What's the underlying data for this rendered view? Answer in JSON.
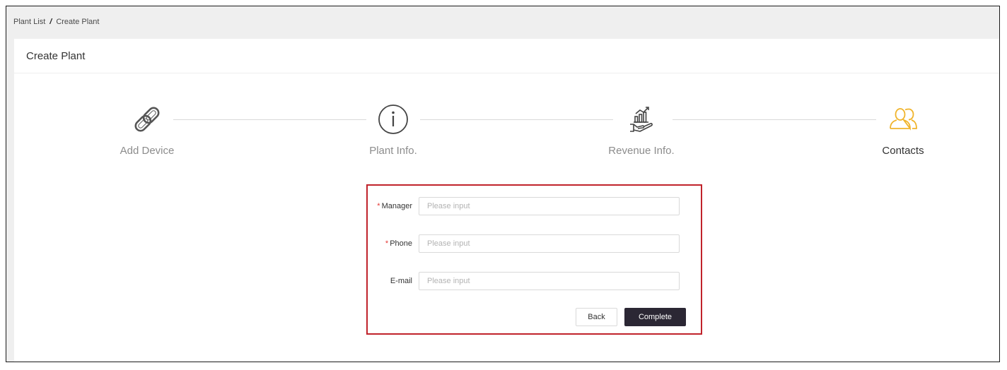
{
  "breadcrumb": {
    "items": [
      "Plant List",
      "Create Plant"
    ],
    "separator": "/"
  },
  "page": {
    "title": "Create Plant"
  },
  "steps": [
    {
      "label": "Add Device",
      "icon": "link-icon",
      "active": false
    },
    {
      "label": "Plant Info.",
      "icon": "info-icon",
      "active": false
    },
    {
      "label": "Revenue Info.",
      "icon": "revenue-icon",
      "active": false
    },
    {
      "label": "Contacts",
      "icon": "contacts-icon",
      "active": true
    }
  ],
  "form": {
    "fields": [
      {
        "label": "Manager",
        "required": true,
        "value": "",
        "placeholder": "Please input"
      },
      {
        "label": "Phone",
        "required": true,
        "value": "",
        "placeholder": "Please input"
      },
      {
        "label": "E-mail",
        "required": false,
        "value": "",
        "placeholder": "Please input"
      }
    ],
    "required_mark": "*",
    "back_label": "Back",
    "complete_label": "Complete"
  },
  "colors": {
    "accent": "#f0b42c",
    "highlight_border": "#c0232b",
    "primary_button": "#2b2734",
    "required": "#e53935"
  }
}
